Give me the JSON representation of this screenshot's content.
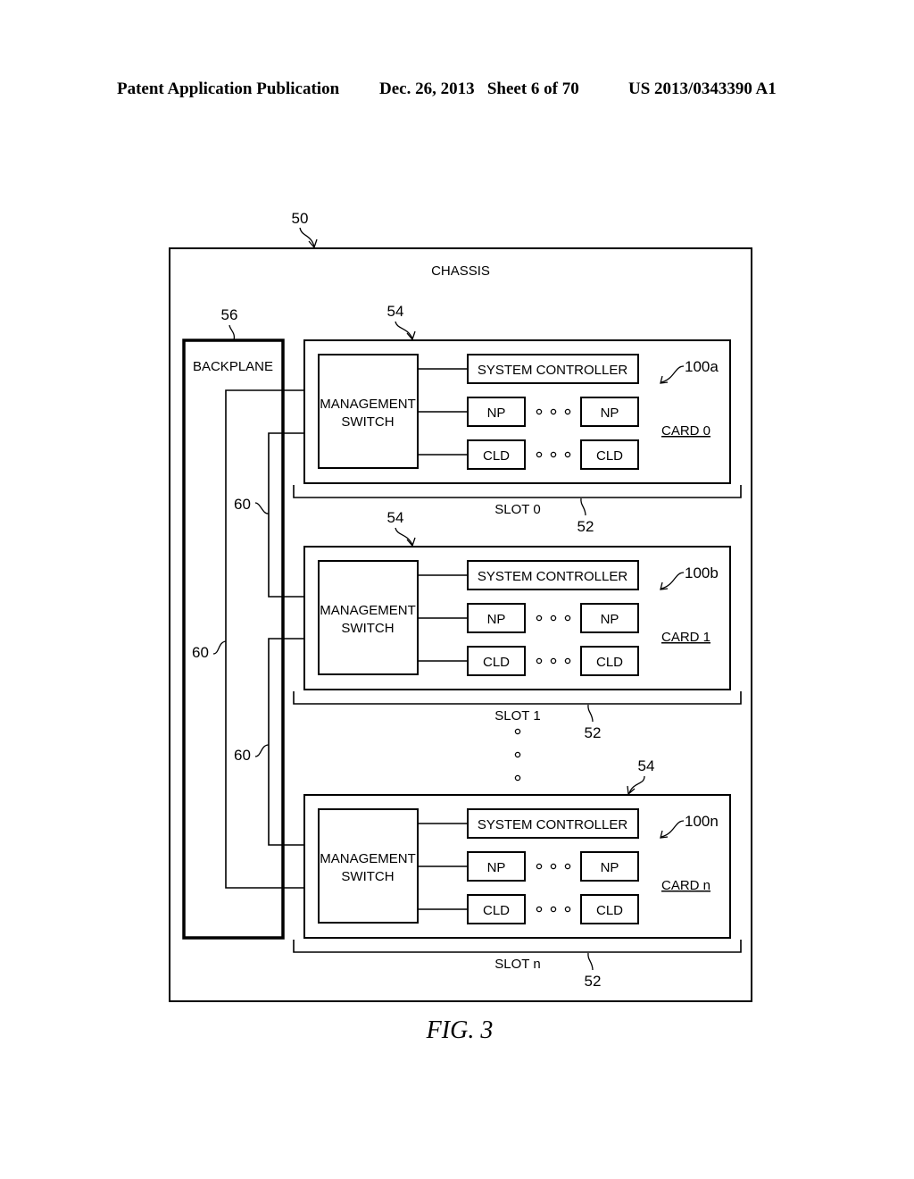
{
  "header": {
    "publication": "Patent Application Publication",
    "date_sheet": "Dec. 26, 2013   Sheet 6 of 70",
    "patent_number": "US 2013/0343390 A1"
  },
  "diagram": {
    "chassis": {
      "label": "CHASSIS",
      "ref": "50"
    },
    "backplane": {
      "label": "BACKPLANE",
      "ref": "56"
    },
    "wire_ref": "60",
    "card_ref": "54",
    "slot_ref": "52",
    "switch_label_1": "MANAGEMENT",
    "switch_label_2": "SWITCH",
    "system_controller": "SYSTEM CONTROLLER",
    "np": "NP",
    "cld": "CLD",
    "cards": [
      {
        "card_label": "CARD 0",
        "ref": "100a",
        "slot_label": "SLOT 0"
      },
      {
        "card_label": "CARD 1",
        "ref": "100b",
        "slot_label": "SLOT 1"
      },
      {
        "card_label": "CARD n",
        "ref": "100n",
        "slot_label": "SLOT n"
      }
    ]
  },
  "caption": "FIG. 3"
}
